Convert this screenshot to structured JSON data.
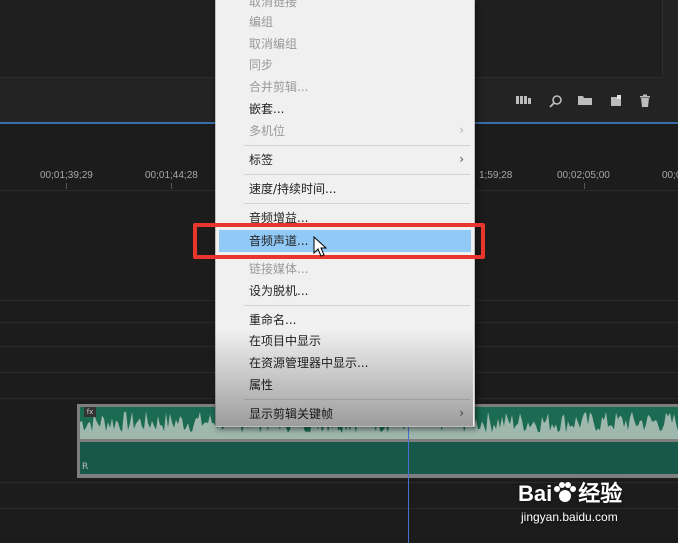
{
  "timecodes": [
    "00;01;39;29",
    "00;01;44;28",
    "1;59;28",
    "00;02;05;00",
    "00;0"
  ],
  "menu": {
    "items": [
      {
        "label": "取消链接",
        "disabled": true
      },
      {
        "label": "编组",
        "disabled": true
      },
      {
        "label": "取消编组",
        "disabled": true
      },
      {
        "label": "同步",
        "disabled": true
      },
      {
        "label": "合并剪辑...",
        "disabled": true
      },
      {
        "label": "嵌套...",
        "disabled": false
      },
      {
        "label": "多机位",
        "disabled": true,
        "submenu": true
      },
      {
        "label": "标签",
        "disabled": false,
        "submenu": true
      },
      {
        "label": "速度/持续时间...",
        "disabled": false
      },
      {
        "label": "音频增益...",
        "disabled": false
      },
      {
        "label": "音频声道...",
        "disabled": false,
        "highlighted": true
      },
      {
        "label": "链接媒体...",
        "disabled": true
      },
      {
        "label": "设为脱机...",
        "disabled": false
      },
      {
        "label": "重命名...",
        "disabled": false
      },
      {
        "label": "在项目中显示",
        "disabled": false
      },
      {
        "label": "在资源管理器中显示...",
        "disabled": false
      },
      {
        "label": "属性",
        "disabled": false
      },
      {
        "label": "显示剪辑关键帧",
        "disabled": false,
        "submenu": true
      }
    ],
    "submenu_arrow": "›"
  },
  "clip": {
    "fx_badge": "fx",
    "channel_label": "R"
  },
  "watermark": {
    "brand": "Bai",
    "brand2": "经验",
    "url": "jingyan.baidu.com"
  },
  "colors": {
    "highlight": "#91c9f7",
    "annotation": "#e8362c",
    "clip": "#1b6a52"
  }
}
